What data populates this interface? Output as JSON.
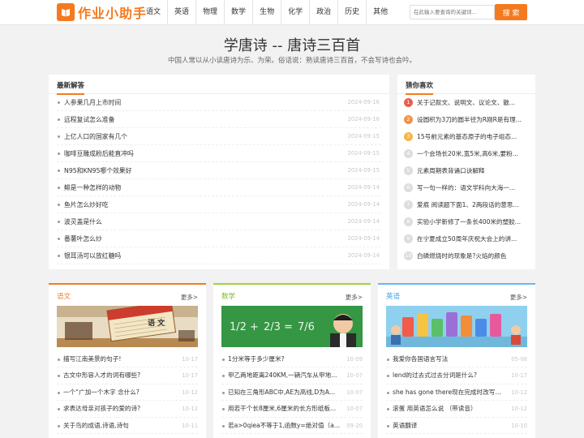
{
  "header": {
    "logo_text": "作业小助手",
    "nav": [
      "语文",
      "英语",
      "物理",
      "数学",
      "生物",
      "化学",
      "政治",
      "历史",
      "其他"
    ],
    "search_placeholder": "在此输入要查询的关键词...",
    "search_button": "搜 索"
  },
  "hero": {
    "title": "学唐诗 -- 唐诗三百首",
    "subtitle": "中国人常以从小读唐诗为乐、为荣。俗话说：熟读唐诗三百首，不会写诗也会吟。"
  },
  "latest": {
    "title": "最新解答",
    "items": [
      {
        "text": "人参果几月上市时间",
        "date": "2024-09-16"
      },
      {
        "text": "远程复试怎么准备",
        "date": "2024-09-16"
      },
      {
        "text": "上亿人口的国家有几个",
        "date": "2024-09-15"
      },
      {
        "text": "咖啡豆雕成粉后能直冲吗",
        "date": "2024-09-15"
      },
      {
        "text": "N95和KN95哪个效果好",
        "date": "2024-09-15"
      },
      {
        "text": "鲱是一种怎样的动物",
        "date": "2024-09-14"
      },
      {
        "text": "鱼片怎么炒好吃",
        "date": "2024-09-14"
      },
      {
        "text": "波灵盖是什么",
        "date": "2024-09-14"
      },
      {
        "text": "番薯叶怎么炒",
        "date": "2024-09-14"
      },
      {
        "text": "银耳汤可以放红糖吗",
        "date": "2024-09-14"
      }
    ]
  },
  "guess": {
    "title": "猜你喜欢",
    "items": [
      {
        "num": "1",
        "color": "#e8604c",
        "text": "关于记叙文、说明文、议论文、散..."
      },
      {
        "num": "2",
        "color": "#f0934a",
        "text": "设圆积为3刀的圆半径为R刚R是有理..."
      },
      {
        "num": "3",
        "color": "#f5b54a",
        "text": "15号前元素的基态原子的电子组态..."
      },
      {
        "num": "4",
        "color": "#dddddd",
        "text": "一个会场长20米,宽5米,高6米,要粉..."
      },
      {
        "num": "5",
        "color": "#dddddd",
        "text": "元素周期表背诵口诀解释"
      },
      {
        "num": "6",
        "color": "#dddddd",
        "text": "写一句一样的：语文学科向大海一..."
      },
      {
        "num": "7",
        "color": "#dddddd",
        "text": "爱痕 阅读题下面1、2两段话的意思..."
      },
      {
        "num": "8",
        "color": "#dddddd",
        "text": "实验小学新修了一条长400米的塑胶..."
      },
      {
        "num": "9",
        "color": "#dddddd",
        "text": "在宁夏成立50周年庆祝大会上的讲..."
      },
      {
        "num": "10",
        "color": "#dddddd",
        "text": "白磷燃烧时的现象是?火焰的颜色"
      }
    ]
  },
  "cards": [
    {
      "title": "语文",
      "more": "更多>",
      "items": [
        {
          "text": "描写江南美景的句子!",
          "date": "10-17"
        },
        {
          "text": "古文中形容人才的词有哪些?",
          "date": "10-17"
        },
        {
          "text": "一个“广加一个木字 念什么?",
          "date": "10-12"
        },
        {
          "text": "求表达母亲对孩子的爱的诗?",
          "date": "10-12"
        },
        {
          "text": "关于鸟的成语,诗语,诗句",
          "date": "10-11"
        }
      ]
    },
    {
      "title": "数学",
      "more": "更多>",
      "items": [
        {
          "text": "1分米等于多少厘米?",
          "date": "10-09"
        },
        {
          "text": "甲乙两地距离240KM,一辆汽车从甲地...",
          "date": "10-07"
        },
        {
          "text": "已知在三角形ABC中,AE为高线,D为A...",
          "date": "10-07"
        },
        {
          "text": "用若干个长8厘米,6厘米的长方形纸板...",
          "date": "10-07"
        },
        {
          "text": "若a>0qiea不等于1,函数y=绝对值（a...",
          "date": "09-20"
        }
      ]
    },
    {
      "title": "英语",
      "more": "更多>",
      "items": [
        {
          "text": "我爱你各国语言写法",
          "date": "05-08"
        },
        {
          "text": "lend的过去式过去分词是什么?",
          "date": "10-17"
        },
        {
          "text": "she has gone there现在完成时改写句子",
          "date": "10-12"
        },
        {
          "text": "滚蛋 用英语怎么说 （带读音）",
          "date": "10-12"
        },
        {
          "text": "英语翻译",
          "date": "10-10"
        }
      ]
    }
  ],
  "images": {
    "chinese_book_label": "语 文",
    "math_board": [
      "1/2 +",
      "2/3 =",
      "7/6"
    ]
  }
}
